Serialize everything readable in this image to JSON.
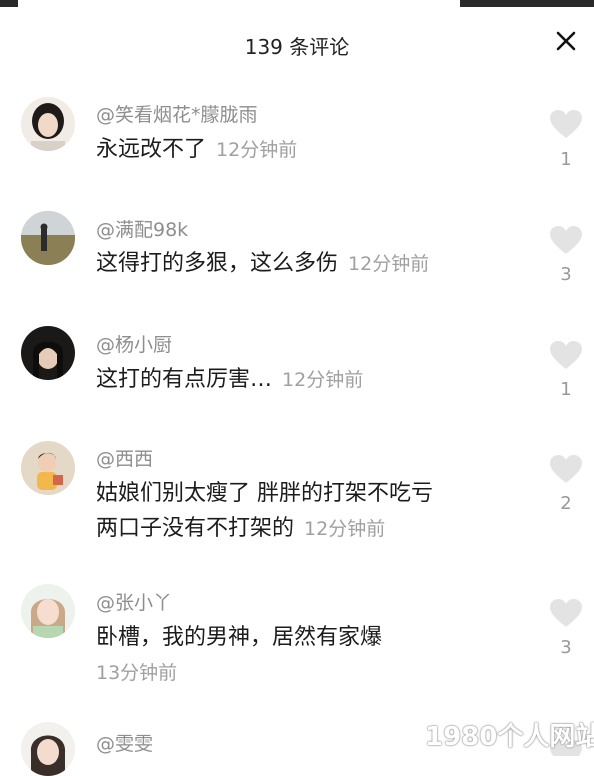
{
  "header": {
    "title": "139 条评论"
  },
  "comments": [
    {
      "username": "@笑看烟花*朦胧雨",
      "text": "永远改不了",
      "text2": "",
      "time": "12分钟前",
      "likes": "1"
    },
    {
      "username": "@满配98k",
      "text": "这得打的多狠，这么多伤",
      "text2": "",
      "time": "12分钟前",
      "likes": "3"
    },
    {
      "username": "@杨小厨",
      "text": "这打的有点厉害…",
      "text2": "",
      "time": "12分钟前",
      "likes": "1"
    },
    {
      "username": "@西西",
      "text": "姑娘们别太瘦了 胖胖的打架不吃亏",
      "text2": "两口子没有不打架的",
      "time": "12分钟前",
      "likes": "2"
    },
    {
      "username": "@张小丫",
      "text": "卧槽，我的男神，居然有家爆",
      "text2": "",
      "time": "13分钟前",
      "likes": "3"
    },
    {
      "username": "@雯雯"
    }
  ],
  "watermark": "1980个人网站",
  "colors": {
    "heart": "#e3e3e3",
    "username": "#8e8e8e",
    "time": "#a0a0a0"
  }
}
